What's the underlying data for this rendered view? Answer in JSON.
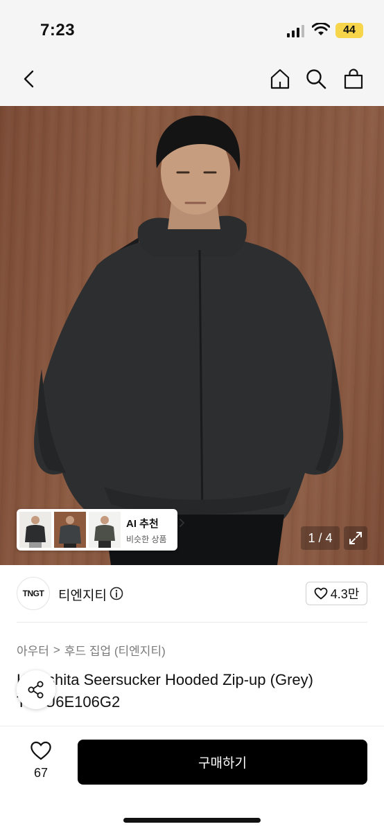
{
  "status_bar": {
    "time": "7:23",
    "battery": "44"
  },
  "nav": {
    "back_icon": "chevron-left-icon",
    "home_icon": "home-icon",
    "search_icon": "search-icon",
    "bag_icon": "shopping-bag-icon"
  },
  "gallery": {
    "current": "1 / 4",
    "similar": {
      "title": "AI 추천",
      "subtitle": "비슷한 상품"
    },
    "wall_color": "#84553f"
  },
  "brand": {
    "logo_text": "TNGT",
    "name": "티엔지티",
    "likes": "4.3만"
  },
  "breadcrumb": {
    "category": "아우터",
    "separator": ">",
    "subcategory": "후드 집업 (티엔지티)"
  },
  "product": {
    "name": "Kinoshita Seersucker Hooded Zip-up (Grey) TNJU6E106G2"
  },
  "bottom": {
    "wish_count": "67",
    "buy_label": "구매하기"
  },
  "colors": {
    "primary": "#000000",
    "battery": "#f6d54a"
  }
}
